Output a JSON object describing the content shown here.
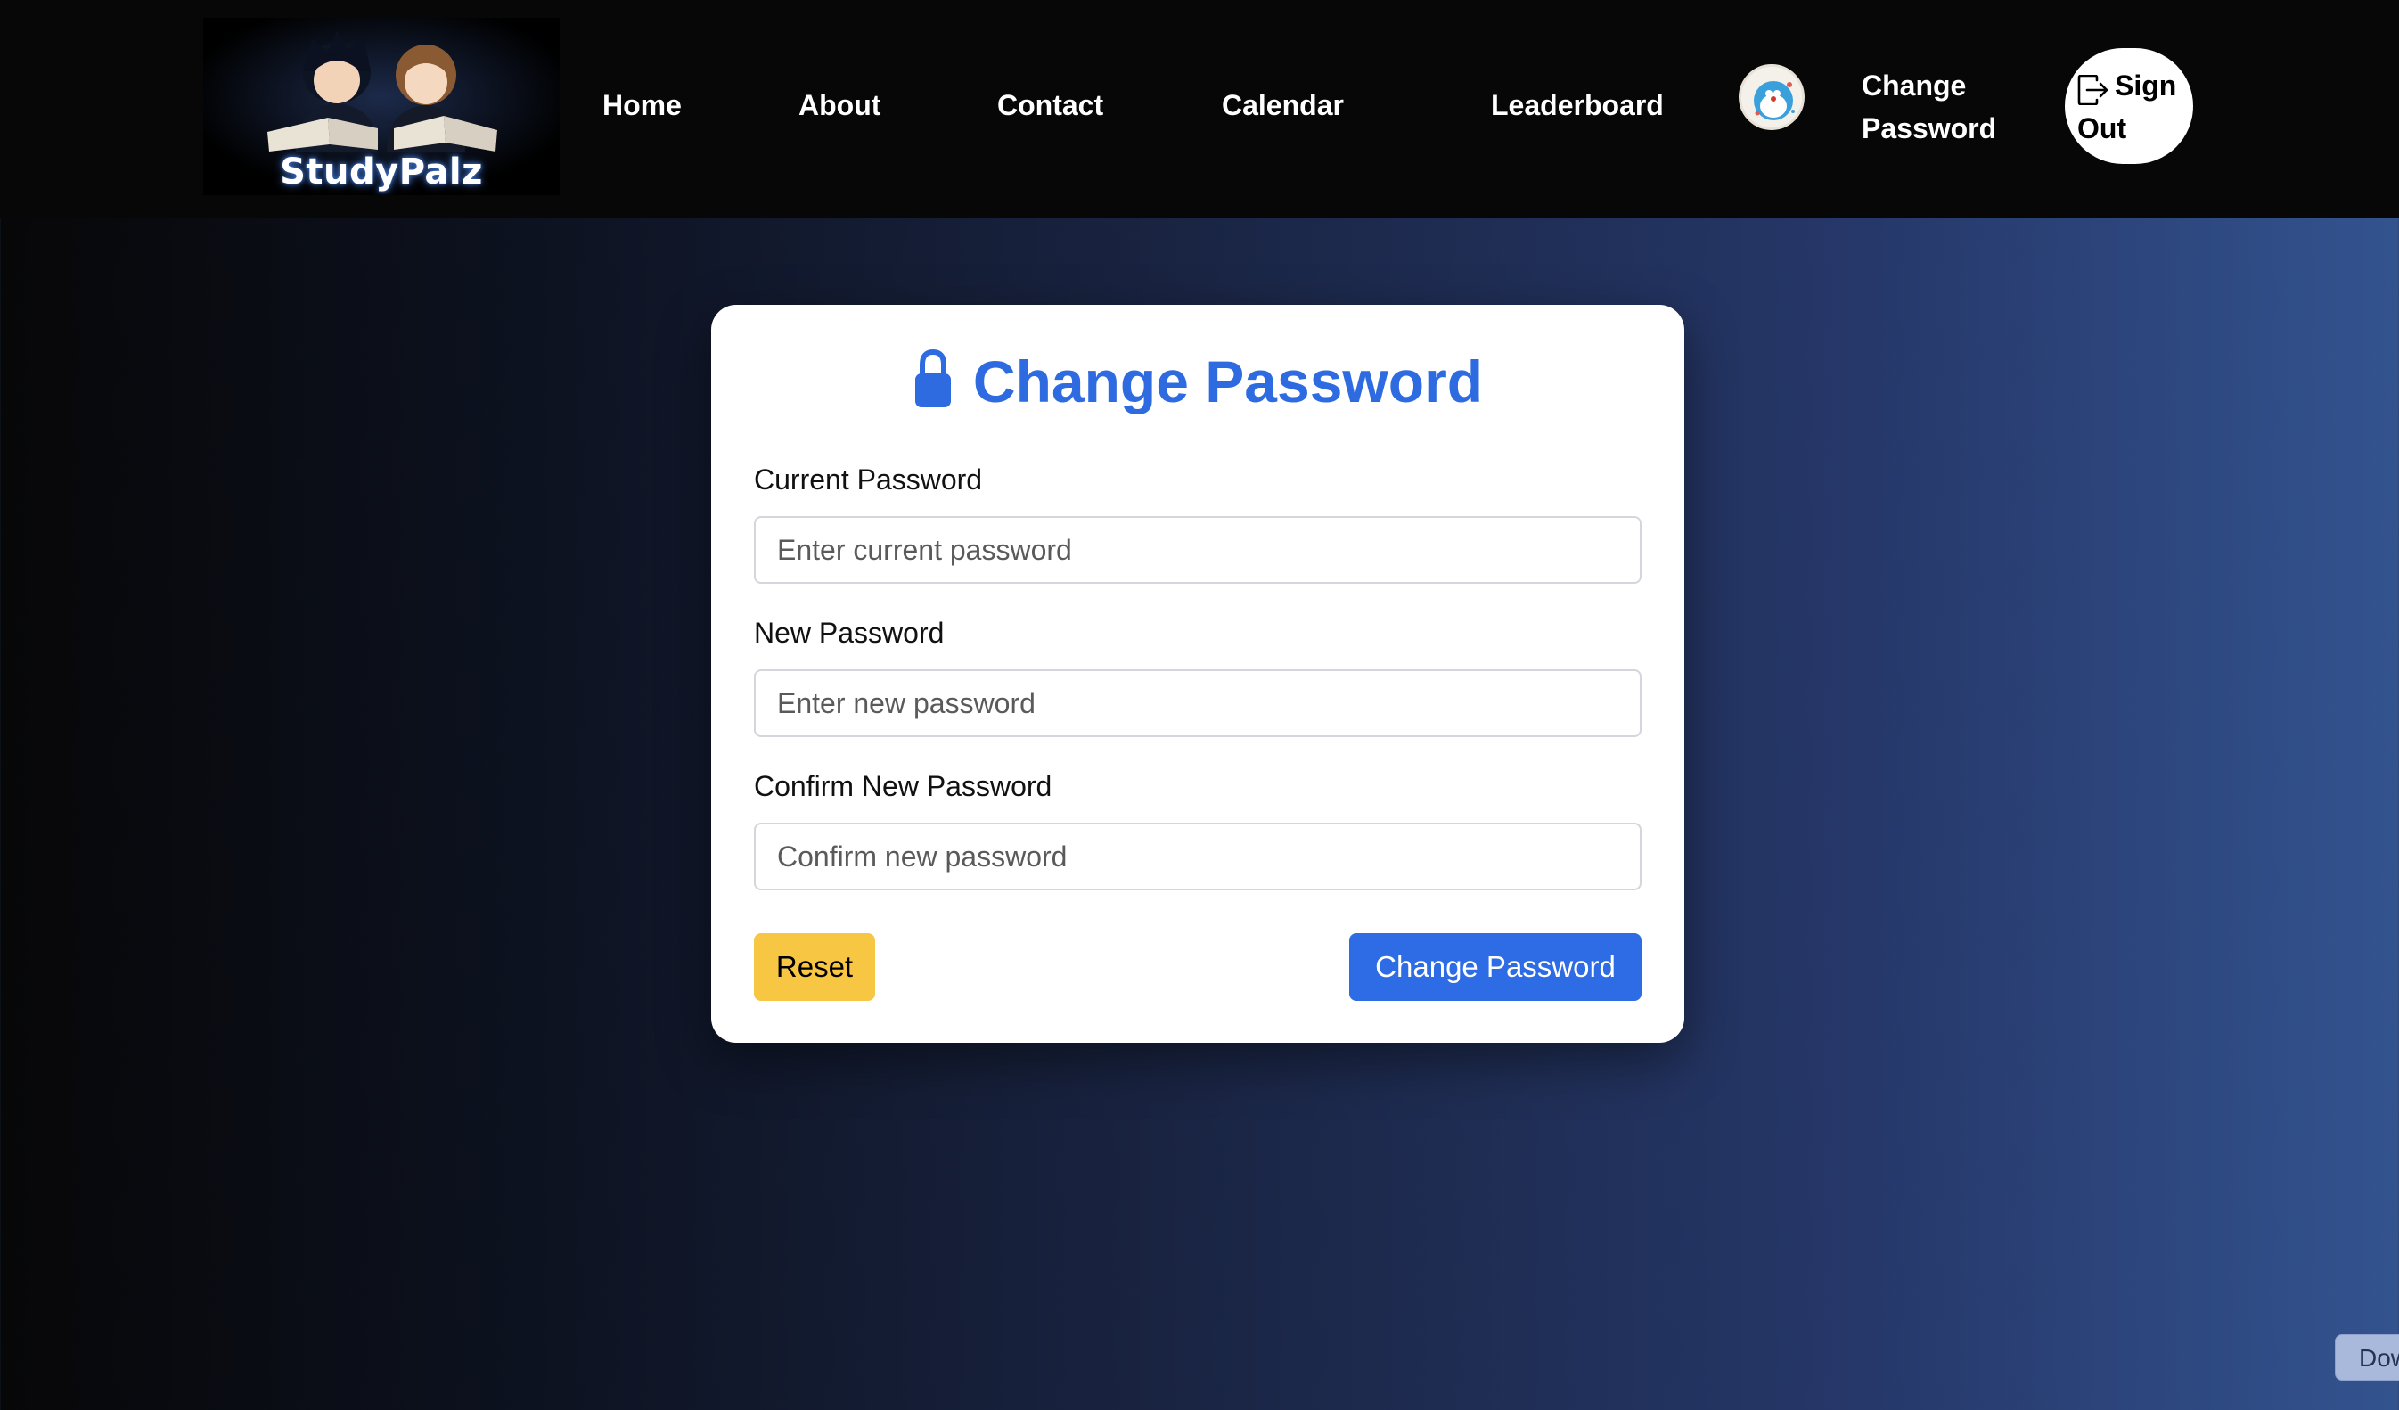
{
  "header": {
    "logo_text": "StudyPalz",
    "nav": {
      "home": "Home",
      "about": "About",
      "contact": "Contact",
      "calendar": "Calendar",
      "leaderboard": "Leaderboard",
      "change_password": "Change Password",
      "sign_out": "Sign Out"
    }
  },
  "card": {
    "title": "Change Password",
    "fields": [
      {
        "label": "Current Password",
        "placeholder": "Enter current password",
        "value": ""
      },
      {
        "label": "New Password",
        "placeholder": "Enter new password",
        "value": ""
      },
      {
        "label": "Confirm New Password",
        "placeholder": "Confirm new password",
        "value": ""
      }
    ],
    "reset_label": "Reset",
    "submit_label": "Change Password"
  },
  "footer": {
    "partial_button_label": "Dow"
  },
  "colors": {
    "accent": "#2e6ce6",
    "reset": "#f7c744",
    "navbar": "#070707"
  },
  "icons": {
    "lock": "lock-icon",
    "sign_out": "sign-out-icon"
  }
}
